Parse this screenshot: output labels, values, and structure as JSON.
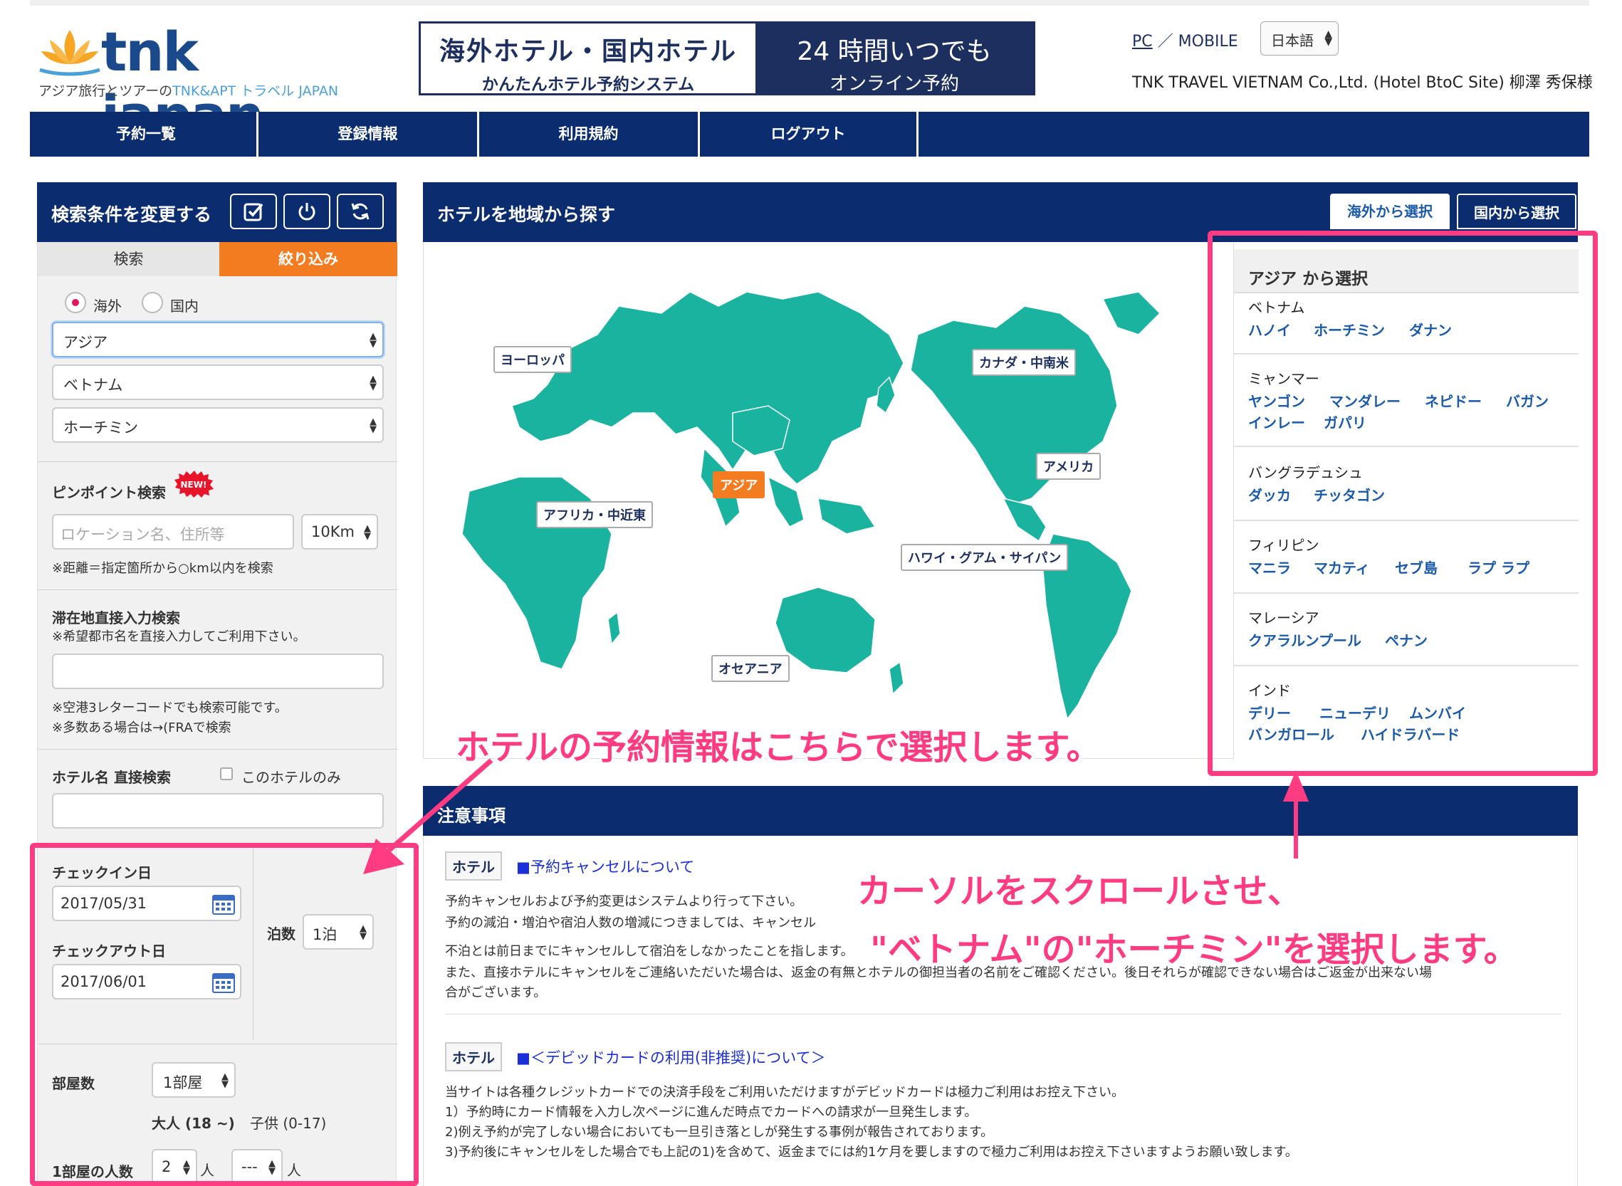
{
  "logo": {
    "brand": "tnk japan",
    "tagline_a": "アジア旅行とツアーの",
    "tagline_b": "TNK&APT トラベル JAPAN"
  },
  "banner": {
    "left_line1": "海外ホテル・国内ホテル",
    "left_line2": "かんたんホテル予約システム",
    "right_line1": "24 時間いつでも",
    "right_line2": "オンライン予約"
  },
  "header": {
    "pc": "PC",
    "slash": "／",
    "mobile": "MOBILE",
    "language": "日本語",
    "company": "TNK TRAVEL VIETNAM Co.,Ltd. (Hotel BtoC Site) 柳澤 秀保様"
  },
  "nav": {
    "items": [
      "予約一覧",
      "登録情報",
      "利用規約",
      "ログアウト"
    ]
  },
  "search": {
    "title": "検索条件を変更する",
    "tab_search": "検索",
    "tab_filter": "絞り込み",
    "radio_overseas": "海外",
    "radio_domestic": "国内",
    "region": "アジア",
    "country": "ベトナム",
    "city": "ホーチミン",
    "pinpoint_label": "ピンポイント検索",
    "new_badge": "NEW!",
    "location_placeholder": "ロケーション名、住所等",
    "distance": "10Km",
    "distance_note": "※距離＝指定箇所から○km以内を検索",
    "direct_label": "滞在地直接入力検索",
    "direct_note": "※希望都市名を直接入力してご利用下さい。",
    "direct_note2": "※空港3レターコードでも検索可能です。",
    "direct_note3": "※多数ある場合は→(FRAで検索",
    "hotel_name_label": "ホテル名 直接検索",
    "this_hotel_only": "このホテルのみ",
    "checkin_label": "チェックイン日",
    "checkin_value": "2017/05/31",
    "checkout_label": "チェックアウト日",
    "checkout_value": "2017/06/01",
    "nights_label": "泊数",
    "nights_value": "1泊",
    "rooms_label": "部屋数",
    "rooms_value": "1部屋",
    "adult_label": "大人 (18 ~)",
    "child_label": "子供 (0-17)",
    "people_label": "1部屋の人数",
    "adults_value": "2",
    "children_value": "---",
    "unit_person": "人"
  },
  "map": {
    "title": "ホテルを地域から探す",
    "tab_overseas": "海外から選択",
    "tab_domestic": "国内から選択",
    "regions": {
      "europe": "ヨーロッパ",
      "canada": "カナダ・中南米",
      "asia": "アジア",
      "america": "アメリカ",
      "africa": "アフリカ・中近東",
      "hawaii": "ハワイ・グアム・サイパン",
      "oceania": "オセアニア"
    },
    "land_color": "#1ab3a0",
    "active_color": "#f47c20"
  },
  "asia_panel": {
    "title": "アジア から選択",
    "countries": [
      {
        "name": "ベトナム",
        "cities": [
          "ハノイ",
          "ホーチミン",
          "ダナン"
        ]
      },
      {
        "name": "ミャンマー",
        "cities": [
          "ヤンゴン",
          "マンダレー",
          "ネピドー",
          "バガン",
          "インレー",
          "ガパリ"
        ]
      },
      {
        "name": "バングラデュシュ",
        "cities": [
          "ダッカ",
          "チッタゴン"
        ]
      },
      {
        "name": "フィリピン",
        "cities": [
          "マニラ",
          "マカティ",
          "セブ島",
          "ラプ ラプ"
        ]
      },
      {
        "name": "マレーシア",
        "cities": [
          "クアラルンプール",
          "ペナン"
        ]
      },
      {
        "name": "インド",
        "cities": [
          "デリー",
          "ニューデリ",
          "ムンバイ",
          "バンガロール",
          "ハイドラバード"
        ]
      }
    ]
  },
  "notices": {
    "title": "注意事項",
    "tag": "ホテル",
    "n1_link": "■予約キャンセルについて",
    "n1_l1": "予約キャンセルおよび予約変更はシステムより行って下さい。",
    "n1_l2": "予約の減泊・増泊や宿泊人数の増減につきましては、キャンセル",
    "n1_l3": "不泊とは前日までにキャンセルして宿泊をしなかったことを指します。",
    "n1_l4": "また、直接ホテルにキャンセルをご連絡いただいた場合は、返金の有無とホテルの御担当者の名前をご確認ください。後日それらが確認できない場合はご返金が出来ない場",
    "n1_l5": "合がございます。",
    "n2_link": "■＜デビッドカードの利用(非推奨)について＞",
    "n2_l1": "当サイトは各種クレジットカードでの決済手段をご利用いただけますがデビッドカードは極力ご利用はお控え下さい。",
    "n2_l2": "1）予約時にカード情報を入力し次ページに進んだ時点でカードへの請求が一旦発生します。",
    "n2_l3": "2)例え予約が完了しない場合においても一旦引き落としが発生する事例が報告されております。",
    "n2_l4": "3)予約後にキャンセルをした場合でも上記の1)を含めて、返金までには約1ケ月を要しますので極力ご利用はお控え下さいますようお願い致します。"
  },
  "annotations": {
    "a1": "ホテルの予約情報はこちらで選択します。",
    "a2": "カーソルをスクロールさせ、",
    "a3": "\"ベトナム\"の\"ホーチミン\"を選択します。",
    "color": "#ff3b82"
  }
}
